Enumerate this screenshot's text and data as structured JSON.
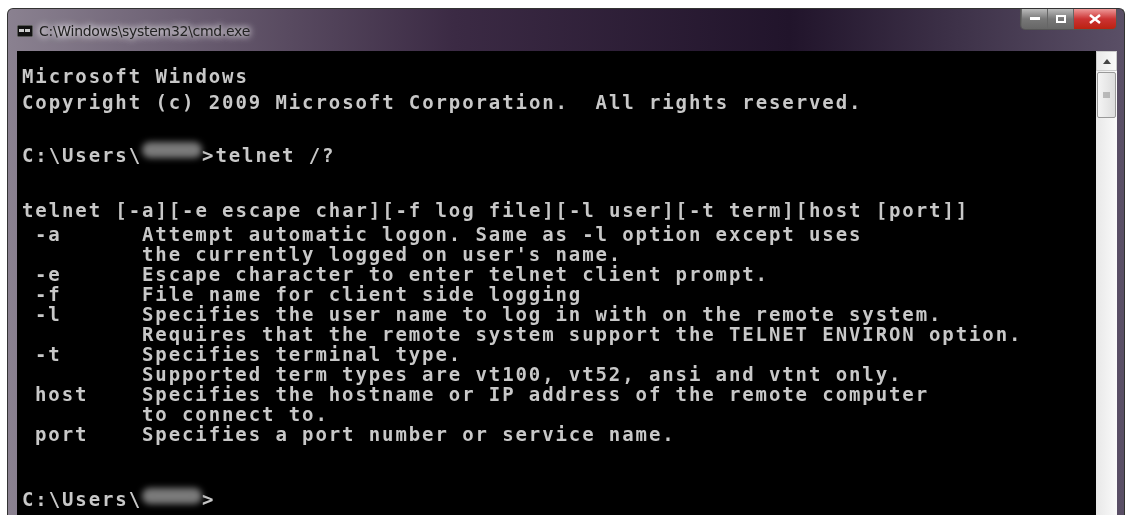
{
  "window": {
    "title": "C:\\Windows\\system32\\cmd.exe"
  },
  "console": {
    "banner": [
      "Microsoft Windows",
      "Copyright (c) 2009 Microsoft Corporation.  All rights reserved."
    ],
    "command_prompt": {
      "path": "C:\\Users\\",
      "command": ">telnet /?"
    },
    "usage": "telnet [-a][-e escape char][-f log file][-l user][-t term][host [port]]",
    "options": [
      {
        "flag": "-a",
        "lines": [
          "Attempt automatic logon. Same as -l option except uses",
          "the currently logged on user's name."
        ]
      },
      {
        "flag": "-e",
        "lines": [
          "Escape character to enter telnet client prompt."
        ]
      },
      {
        "flag": "-f",
        "lines": [
          "File name for client side logging"
        ]
      },
      {
        "flag": "-l",
        "lines": [
          "Specifies the user name to log in with on the remote system.",
          "Requires that the remote system support the TELNET ENVIRON option."
        ]
      },
      {
        "flag": "-t",
        "lines": [
          "Specifies terminal type.",
          "Supported term types are vt100, vt52, ansi and vtnt only."
        ]
      },
      {
        "flag": "host",
        "lines": [
          "Specifies the hostname or IP address of the remote computer",
          "to connect to."
        ]
      },
      {
        "flag": "port",
        "lines": [
          "Specifies a port number or service name."
        ]
      }
    ],
    "final_prompt": {
      "path": "C:\\Users\\",
      "command": ">"
    }
  }
}
